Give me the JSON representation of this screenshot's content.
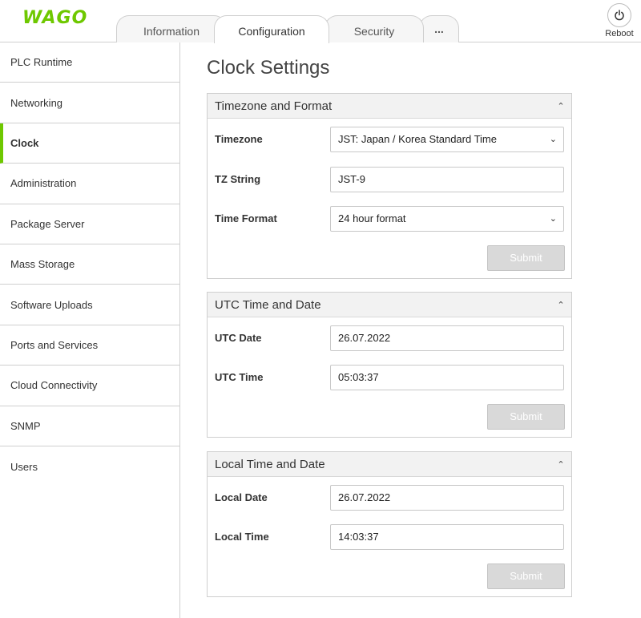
{
  "header": {
    "logo": "WAGO",
    "tabs": [
      "Information",
      "Configuration",
      "Security",
      "..."
    ],
    "active_tab": "Configuration",
    "reboot_label": "Reboot",
    "reboot_icon": "power-icon"
  },
  "sidebar": {
    "items": [
      "PLC Runtime",
      "Networking",
      "Clock",
      "Administration",
      "Package Server",
      "Mass Storage",
      "Software Uploads",
      "Ports and Services",
      "Cloud Connectivity",
      "SNMP",
      "Users"
    ],
    "active": "Clock"
  },
  "main": {
    "title": "Clock Settings",
    "panels": [
      {
        "title": "Timezone and Format",
        "fields": [
          {
            "label": "Timezone",
            "value": "JST: Japan / Korea Standard Time",
            "type": "select"
          },
          {
            "label": "TZ String",
            "value": "JST-9",
            "type": "text"
          },
          {
            "label": "Time Format",
            "value": "24 hour format",
            "type": "select"
          }
        ],
        "submit_label": "Submit"
      },
      {
        "title": "UTC Time and Date",
        "fields": [
          {
            "label": "UTC Date",
            "value": "26.07.2022",
            "type": "text"
          },
          {
            "label": "UTC Time",
            "value": "05:03:37",
            "type": "text"
          }
        ],
        "submit_label": "Submit"
      },
      {
        "title": "Local Time and Date",
        "fields": [
          {
            "label": "Local Date",
            "value": "26.07.2022",
            "type": "text"
          },
          {
            "label": "Local Time",
            "value": "14:03:37",
            "type": "text"
          }
        ],
        "submit_label": "Submit"
      }
    ]
  },
  "colors": {
    "accent": "#6ec800",
    "border": "#cfcfcf",
    "panel_header": "#f2f2f2",
    "button_disabled": "#d9d9d9"
  }
}
